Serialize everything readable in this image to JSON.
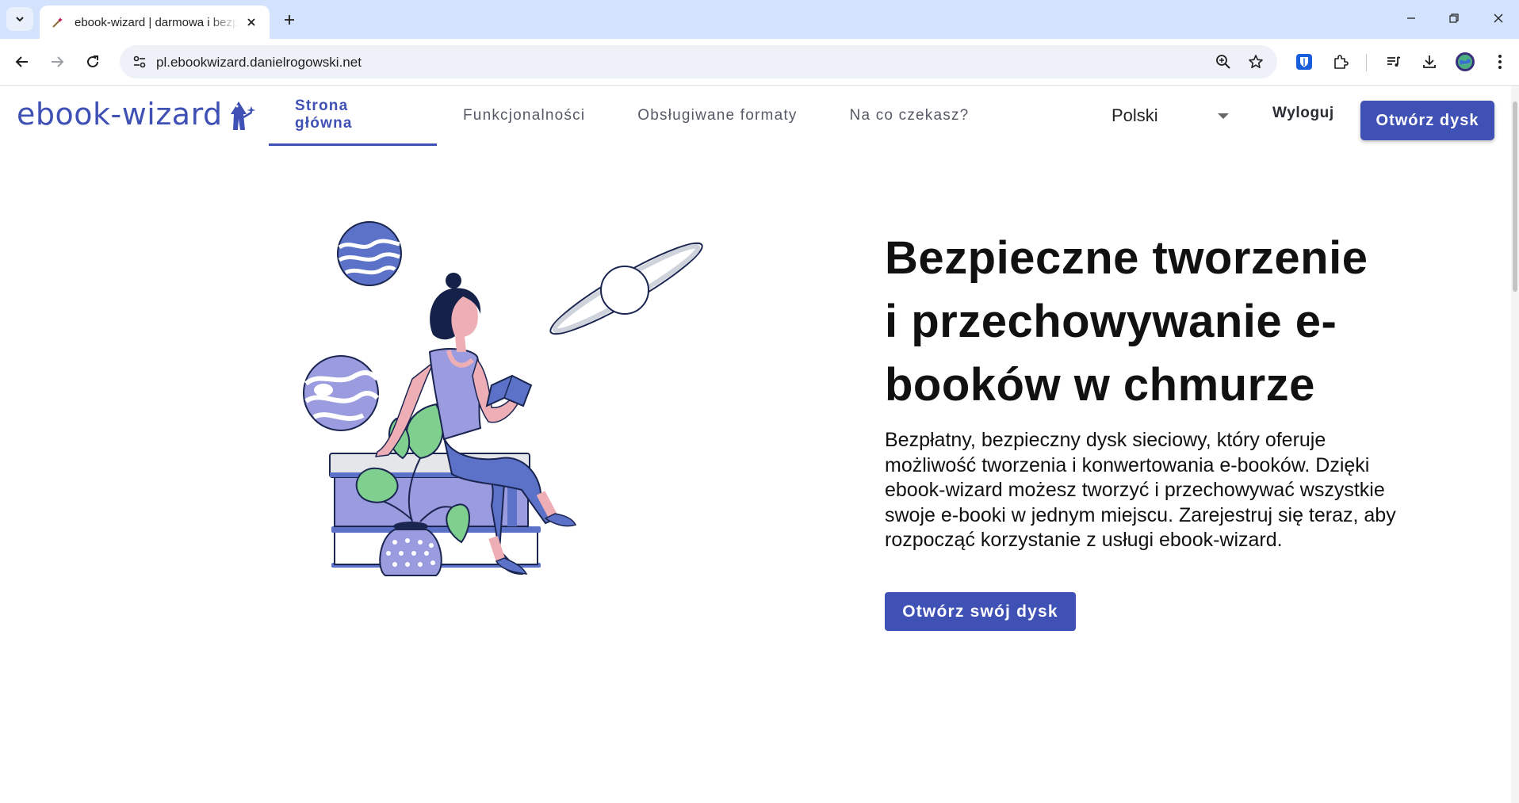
{
  "browser": {
    "tab_title": "ebook-wizard | darmowa i bezpieczna chmura na e-booki",
    "url": "pl.ebookwizard.danielrogowski.net"
  },
  "header": {
    "logo": "ebook-wizard",
    "nav": [
      {
        "label": "Strona główna",
        "active": true
      },
      {
        "label": "Funkcjonalności",
        "active": false
      },
      {
        "label": "Obsługiwane formaty",
        "active": false
      },
      {
        "label": "Na co czekasz?",
        "active": false
      }
    ],
    "language": "Polski",
    "logout": "Wyloguj",
    "open_drive": "Otwórz dysk"
  },
  "hero": {
    "title": "Bezpieczne tworzenie i przechowywanie e-booków w chmurze",
    "description": "Bezpłatny, bezpieczny dysk sieciowy, który oferuje możliwość tworzenia i konwertowania e-booków. Dzięki ebook-wizard możesz tworzyć i przechowywać wszystkie swoje e-booki w jednym miejscu. Zarejestruj się teraz, aby rozpocząć korzystanie z usługi ebook-wizard.",
    "cta": "Otwórz swój dysk"
  },
  "colors": {
    "primary": "#3f51b5",
    "tabstrip": "#d3e3fd",
    "illustration_purple": "#9b9be0",
    "illustration_blue": "#5b72c8",
    "illustration_green": "#7fcf8f",
    "illustration_pink": "#eeaeb5"
  }
}
